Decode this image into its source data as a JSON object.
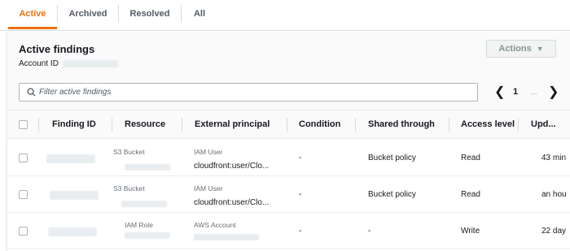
{
  "tabs": [
    {
      "label": "Active"
    },
    {
      "label": "Archived"
    },
    {
      "label": "Resolved"
    },
    {
      "label": "All"
    }
  ],
  "panel": {
    "title": "Active findings",
    "account_label": "Account ID",
    "actions_label": "Actions",
    "actions_caret": "▼"
  },
  "search": {
    "placeholder": "Filter active findings"
  },
  "pager": {
    "prev": "❮",
    "page": "1",
    "dots": "...",
    "next": "❯"
  },
  "columns": [
    "Finding ID",
    "Resource",
    "External principal",
    "Condition",
    "Shared through",
    "Access level",
    "Upd..."
  ],
  "rows": [
    {
      "resource_type": "S3 Bucket",
      "principal_type": "IAM User",
      "principal_value": "cloudfront:user/Clo...",
      "condition": "-",
      "shared_through": "Bucket policy",
      "access_level": "Read",
      "updated": "43 min"
    },
    {
      "resource_type": "S3 Bucket",
      "principal_type": "IAM User",
      "principal_value": "cloudfront:user/Clo...",
      "condition": "-",
      "shared_through": "Bucket policy",
      "access_level": "Read",
      "updated": "an hou"
    },
    {
      "resource_type": "IAM Role",
      "principal_type": "AWS Account",
      "principal_value": "",
      "condition": "-",
      "shared_through": "-",
      "access_level": "Write",
      "updated": "22 day"
    }
  ],
  "colors": {
    "accent": "#ec7211",
    "border": "#eaeded",
    "header_bg": "#fafafa"
  },
  "icons": {
    "search": "search-icon",
    "caret": "caret-down-icon",
    "prev": "chevron-left-icon",
    "next": "chevron-right-icon"
  }
}
